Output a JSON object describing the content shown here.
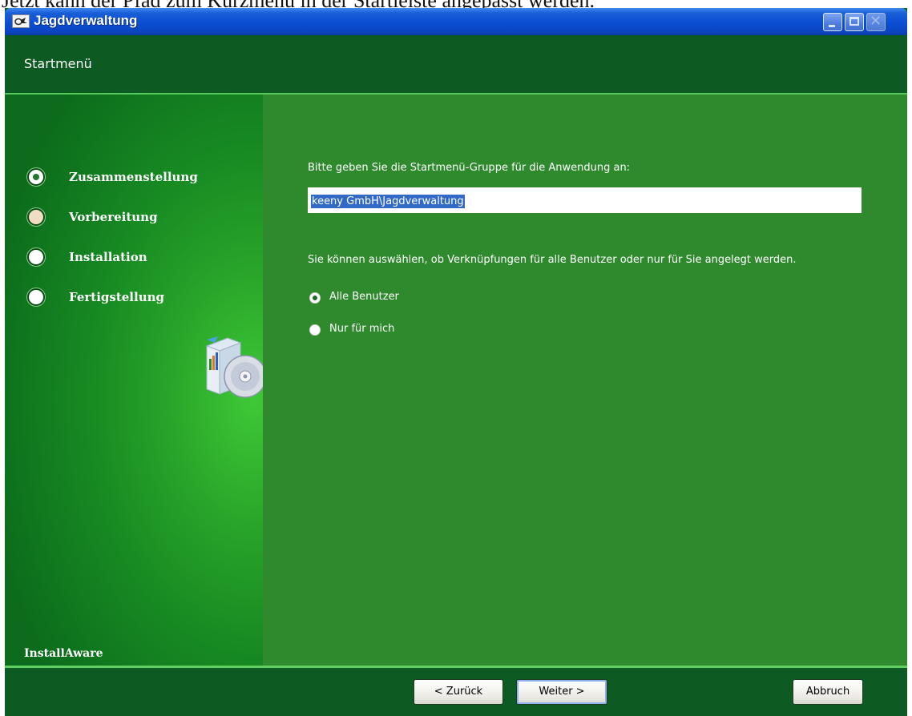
{
  "document": {
    "caption": "Jetzt kann der Pfad zum Kurzmenü in der Startleiste angepasst werden."
  },
  "window": {
    "title": "Jagdverwaltung",
    "header_title": "Startmenü"
  },
  "sidebar": {
    "steps": [
      {
        "label": "Zusammenstellung",
        "state": "done"
      },
      {
        "label": "Vorbereitung",
        "state": "current"
      },
      {
        "label": "Installation",
        "state": "pending"
      },
      {
        "label": "Fertigstellung",
        "state": "pending"
      }
    ],
    "brand": "InstallAware"
  },
  "content": {
    "instruction": "Bitte geben Sie die Startmenü-Gruppe für die Anwendung an:",
    "group_value": "keeny GmbH\\Jagdverwaltung",
    "scope_hint": "Sie können auswählen, ob Verknüpfungen für alle Benutzer oder nur für Sie angelegt werden.",
    "options": [
      {
        "label": "Alle Benutzer",
        "checked": true
      },
      {
        "label": "Nur für mich",
        "checked": false
      }
    ]
  },
  "footer": {
    "back_label": "< Zurück",
    "next_label": "Weiter >",
    "cancel_label": "Abbruch"
  },
  "colors": {
    "titlebar": "#0b4ed3",
    "header": "#0d5a22",
    "content_bg": "#2f8a2d",
    "accent_line": "#57c95c"
  }
}
